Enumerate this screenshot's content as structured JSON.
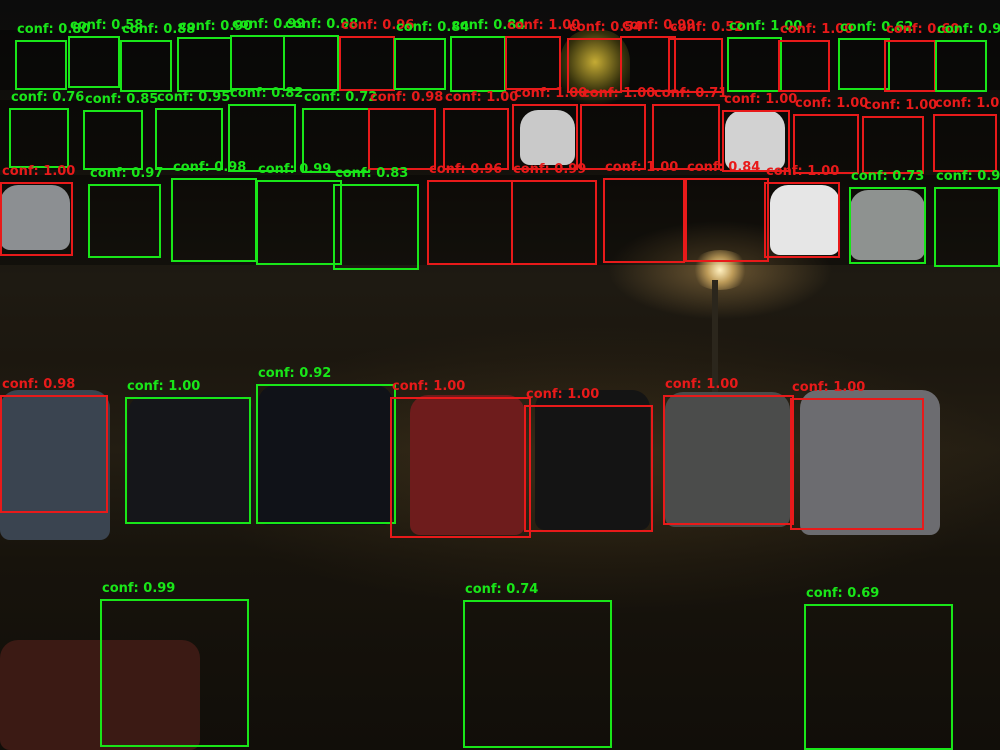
{
  "scene": {
    "description_colors": {
      "asphalt": "#1e1a12",
      "night_sky": "#0c0c0c"
    }
  },
  "legend": {
    "green_color": "#19e619",
    "red_color": "#e81a1a"
  },
  "detections": [
    {
      "label": "conf: 0.80",
      "cls": "g"
    },
    {
      "label": "conf: 0.58",
      "cls": "g"
    },
    {
      "label": "conf: 0.88",
      "cls": "g"
    },
    {
      "label": "conf: 0.90",
      "cls": "g"
    },
    {
      "label": "conf: 0.99",
      "cls": "g"
    },
    {
      "label": "conf: 0.98",
      "cls": "g"
    },
    {
      "label": "conf: 0.96",
      "cls": "r"
    },
    {
      "label": "conf: 0.84",
      "cls": "g"
    },
    {
      "label": "conf: 0.84",
      "cls": "g"
    },
    {
      "label": "conf: 1.00",
      "cls": "r"
    },
    {
      "label": "conf: 0.54",
      "cls": "r"
    },
    {
      "label": "conf: 0.99",
      "cls": "r"
    },
    {
      "label": "conf: 0.52",
      "cls": "r"
    },
    {
      "label": "conf: 1.00",
      "cls": "g"
    },
    {
      "label": "conf: 1.00",
      "cls": "r"
    },
    {
      "label": "conf: 0.62",
      "cls": "g"
    },
    {
      "label": "conf: 0.60",
      "cls": "r"
    },
    {
      "label": "conf: 0.9",
      "cls": "g"
    },
    {
      "label": "conf: 0.76",
      "cls": "g"
    },
    {
      "label": "conf: 0.85",
      "cls": "g"
    },
    {
      "label": "conf: 0.95",
      "cls": "g"
    },
    {
      "label": "conf: 0.82",
      "cls": "g"
    },
    {
      "label": "conf: 0.72",
      "cls": "g"
    },
    {
      "label": "conf: 0.98",
      "cls": "r"
    },
    {
      "label": "conf: 1.00",
      "cls": "r"
    },
    {
      "label": "conf: 1.00",
      "cls": "r"
    },
    {
      "label": "conf: 1.00",
      "cls": "r"
    },
    {
      "label": "conf: 0.71",
      "cls": "r"
    },
    {
      "label": "conf: 1.00",
      "cls": "r"
    },
    {
      "label": "conf: 1.00",
      "cls": "r"
    },
    {
      "label": "conf: 1.00",
      "cls": "r"
    },
    {
      "label": "conf: 1.0",
      "cls": "r"
    },
    {
      "label": "conf: 1.00",
      "cls": "r"
    },
    {
      "label": "conf: 0.97",
      "cls": "g"
    },
    {
      "label": "conf: 0.98",
      "cls": "g"
    },
    {
      "label": "conf: 0.99",
      "cls": "g"
    },
    {
      "label": "conf: 0.83",
      "cls": "g"
    },
    {
      "label": "conf: 0.96",
      "cls": "r"
    },
    {
      "label": "conf: 0.99",
      "cls": "r"
    },
    {
      "label": "conf: 1.00",
      "cls": "r"
    },
    {
      "label": "conf: 0.84",
      "cls": "r"
    },
    {
      "label": "conf: 1.00",
      "cls": "r"
    },
    {
      "label": "conf: 0.73",
      "cls": "g"
    },
    {
      "label": "conf: 0.9",
      "cls": "g"
    },
    {
      "label": "conf: 0.98",
      "cls": "r"
    },
    {
      "label": "conf: 1.00",
      "cls": "g"
    },
    {
      "label": "conf: 0.92",
      "cls": "g"
    },
    {
      "label": "conf: 1.00",
      "cls": "r"
    },
    {
      "label": "conf: 1.00",
      "cls": "r"
    },
    {
      "label": "conf: 1.00",
      "cls": "r"
    },
    {
      "label": "conf: 1.00",
      "cls": "r"
    },
    {
      "label": "conf: 0.99",
      "cls": "g"
    },
    {
      "label": "conf: 0.74",
      "cls": "g"
    },
    {
      "label": "conf: 0.69",
      "cls": "g"
    }
  ]
}
